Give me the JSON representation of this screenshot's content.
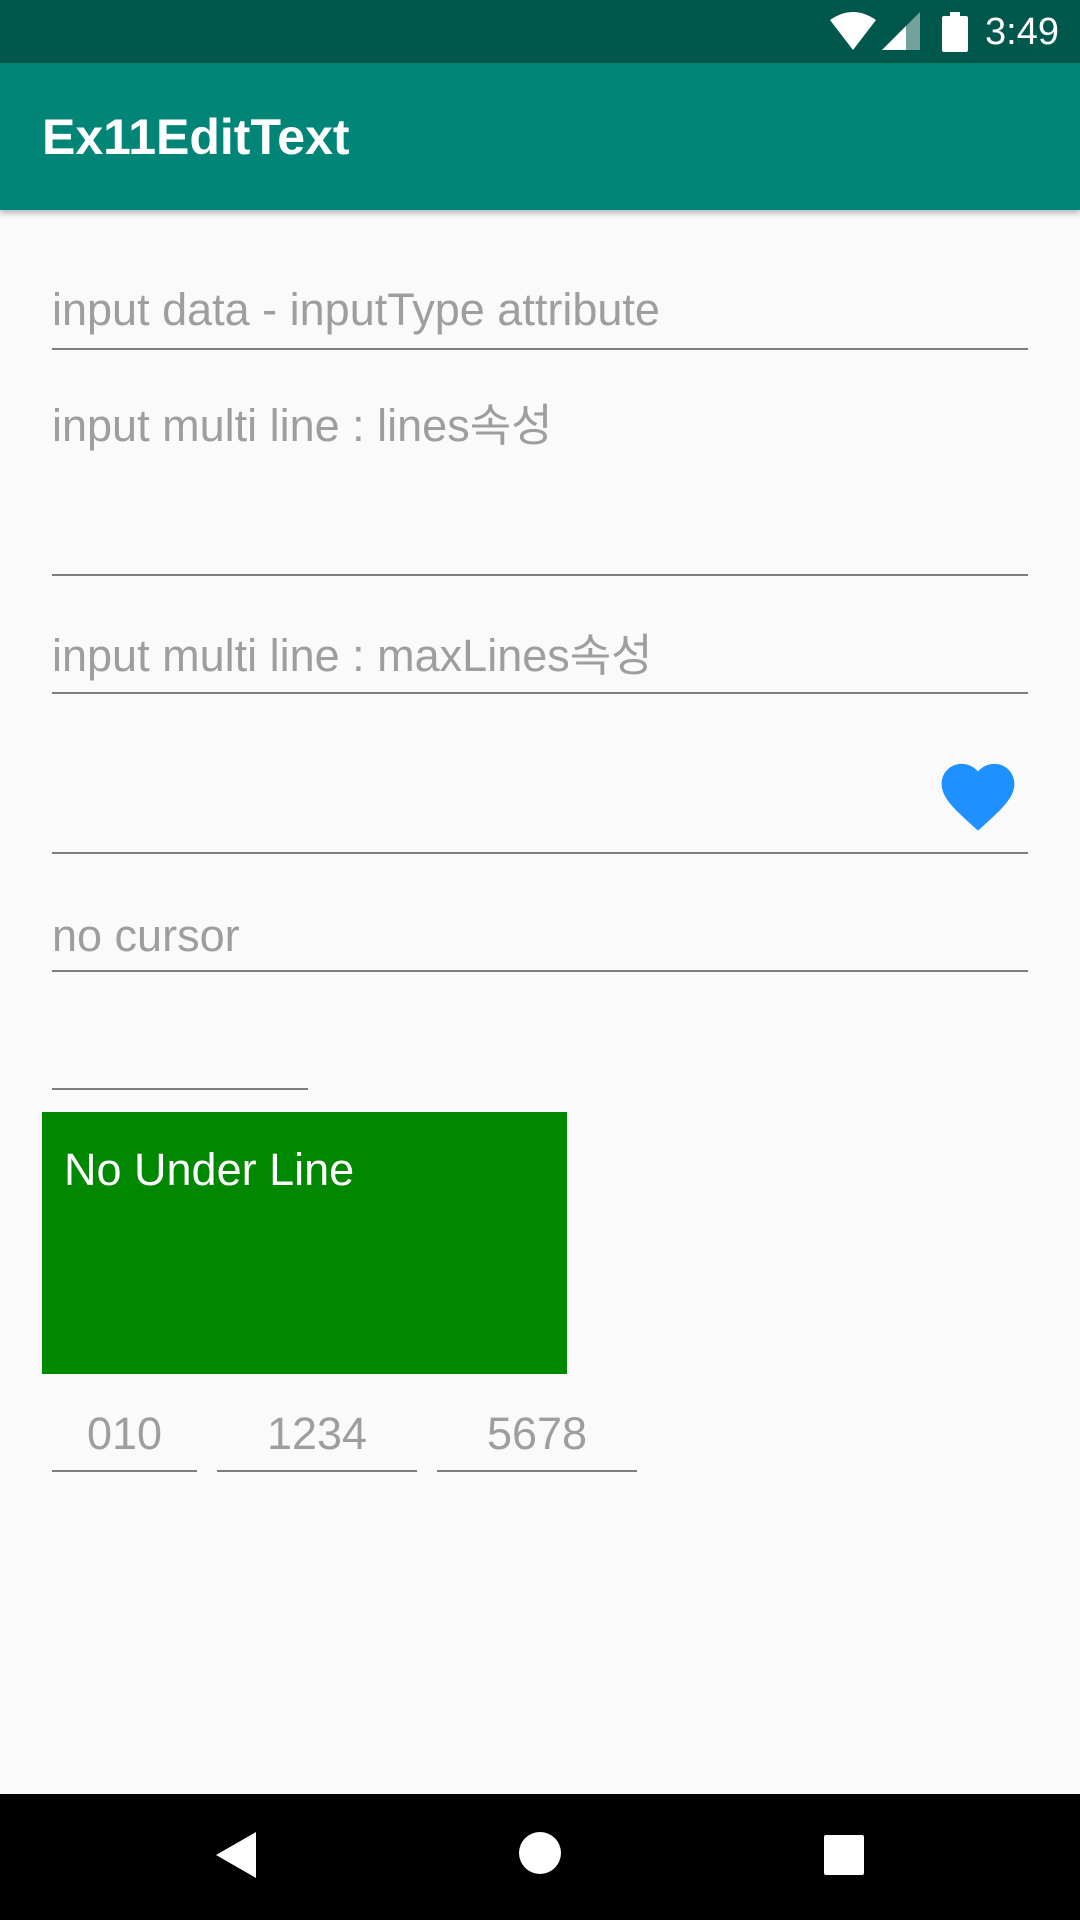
{
  "status_bar": {
    "time": "3:49",
    "icons": [
      "wifi-icon",
      "signal-icon",
      "battery-icon"
    ]
  },
  "toolbar": {
    "title": "Ex11EditText"
  },
  "fields": {
    "input_type": {
      "hint": "input data - inputType attribute"
    },
    "lines": {
      "hint": "input multi line : lines속성"
    },
    "max_lines": {
      "hint": "input multi line : maxLines속성"
    },
    "drawable": {
      "hint": "",
      "icon": "heart-icon",
      "icon_color": "#1e90ff"
    },
    "no_cursor": {
      "hint": "no cursor"
    },
    "short": {
      "hint": ""
    }
  },
  "no_underline": {
    "text": "No Under Line",
    "background": "#008800"
  },
  "phone": {
    "part1": "010",
    "part2": "1234",
    "part3": "5678"
  },
  "nav_bar": {
    "icons": [
      "back-icon",
      "home-icon",
      "recents-icon"
    ]
  },
  "colors": {
    "primary": "#008577",
    "primary_dark": "#00574b",
    "hint": "#9e9e9e",
    "underline": "#7e7e7e"
  }
}
